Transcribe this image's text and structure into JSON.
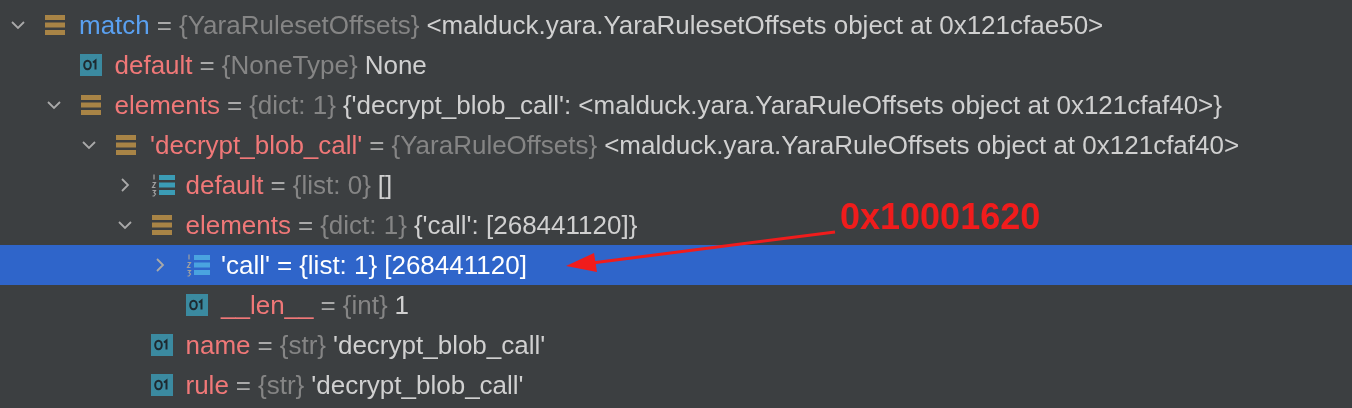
{
  "variables": [
    {
      "kind": "object",
      "name": "match",
      "eq": "=",
      "type": "{YaraRulesetOffsets}",
      "value": "<malduck.yara.YaraRulesetOffsets object at 0x121cfae50>",
      "expanded": true,
      "selected": false,
      "children": [
        {
          "kind": "value",
          "name": "default",
          "eq": "=",
          "type": "{NoneType}",
          "value": "None",
          "selected": false
        },
        {
          "kind": "object",
          "name": "elements",
          "eq": "=",
          "type": "{dict: 1}",
          "value": "{'decrypt_blob_call': <malduck.yara.YaraRuleOffsets object at 0x121cfaf40>}",
          "expanded": true,
          "selected": false,
          "children": [
            {
              "kind": "object",
              "name": "'decrypt_blob_call'",
              "eq": "=",
              "type": "{YaraRuleOffsets}",
              "value": "<malduck.yara.YaraRuleOffsets object at 0x121cfaf40>",
              "expanded": true,
              "selected": false,
              "children": [
                {
                  "kind": "list",
                  "name": "default",
                  "eq": "=",
                  "type": "{list: 0}",
                  "value": "[]",
                  "expanded": false,
                  "selected": false
                },
                {
                  "kind": "object",
                  "name": "elements",
                  "eq": "=",
                  "type": "{dict: 1}",
                  "value": "{'call': [268441120]}",
                  "expanded": true,
                  "selected": false,
                  "children": [
                    {
                      "kind": "list",
                      "name": "'call'",
                      "eq": "=",
                      "type": "{list: 1}",
                      "value": "[268441120]",
                      "expanded": false,
                      "selected": true
                    },
                    {
                      "kind": "value",
                      "name": "__len__",
                      "eq": "=",
                      "type": "{int}",
                      "value": "1",
                      "selected": false
                    }
                  ]
                },
                {
                  "kind": "value",
                  "name": "name",
                  "eq": "=",
                  "type": "{str}",
                  "value": "'decrypt_blob_call'",
                  "selected": false
                },
                {
                  "kind": "value",
                  "name": "rule",
                  "eq": "=",
                  "type": "{str}",
                  "value": "'decrypt_blob_call'",
                  "selected": false
                }
              ]
            }
          ]
        }
      ]
    }
  ],
  "annotation": {
    "label": "0x10001620"
  }
}
